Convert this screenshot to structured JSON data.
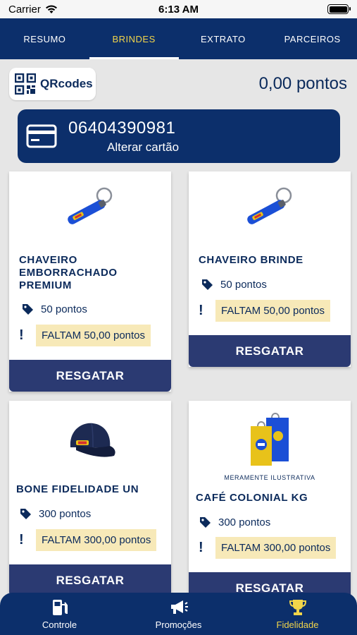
{
  "status_bar": {
    "carrier": "Carrier",
    "time": "6:13 AM"
  },
  "top_tabs": [
    {
      "label": "RESUMO",
      "active": false
    },
    {
      "label": "BRINDES",
      "active": true
    },
    {
      "label": "EXTRATO",
      "active": false
    },
    {
      "label": "PARCEIROS",
      "active": false
    }
  ],
  "qr": {
    "label": "QRcodes"
  },
  "points": "0,00 pontos",
  "card": {
    "number": "06404390981",
    "change_label": "Alterar cartão"
  },
  "products": [
    {
      "image": "keychain",
      "title": "CHAVEIRO EMBORRACHADO PREMIUM",
      "price": "50 pontos",
      "missing": "FALTAM 50,00 pontos",
      "action": "RESGATAR"
    },
    {
      "image": "keychain",
      "title": "CHAVEIRO BRINDE",
      "price": "50 pontos",
      "missing": "FALTAM 50,00 pontos",
      "action": "RESGATAR"
    },
    {
      "image": "cap",
      "title": "BONE FIDELIDADE UN",
      "price": "300 pontos",
      "missing": "FALTAM 300,00 pontos",
      "action": "RESGATAR"
    },
    {
      "image": "bags",
      "caption": "MERAMENTE ILUSTRATIVA",
      "title": "CAFÉ COLONIAL KG",
      "price": "300 pontos",
      "missing": "FALTAM 300,00 pontos",
      "action": "RESGATAR"
    }
  ],
  "bottom_nav": [
    {
      "label": "Controle",
      "icon": "gas-pump-icon",
      "active": false
    },
    {
      "label": "Promoções",
      "icon": "megaphone-icon",
      "active": false
    },
    {
      "label": "Fidelidade",
      "icon": "trophy-icon",
      "active": true
    }
  ],
  "colors": {
    "navy": "#0c2f6b",
    "button": "#2b3a72",
    "active_tab": "#f2d54a",
    "missing_bg": "#f7e9b8",
    "background": "#e6e6e6"
  }
}
